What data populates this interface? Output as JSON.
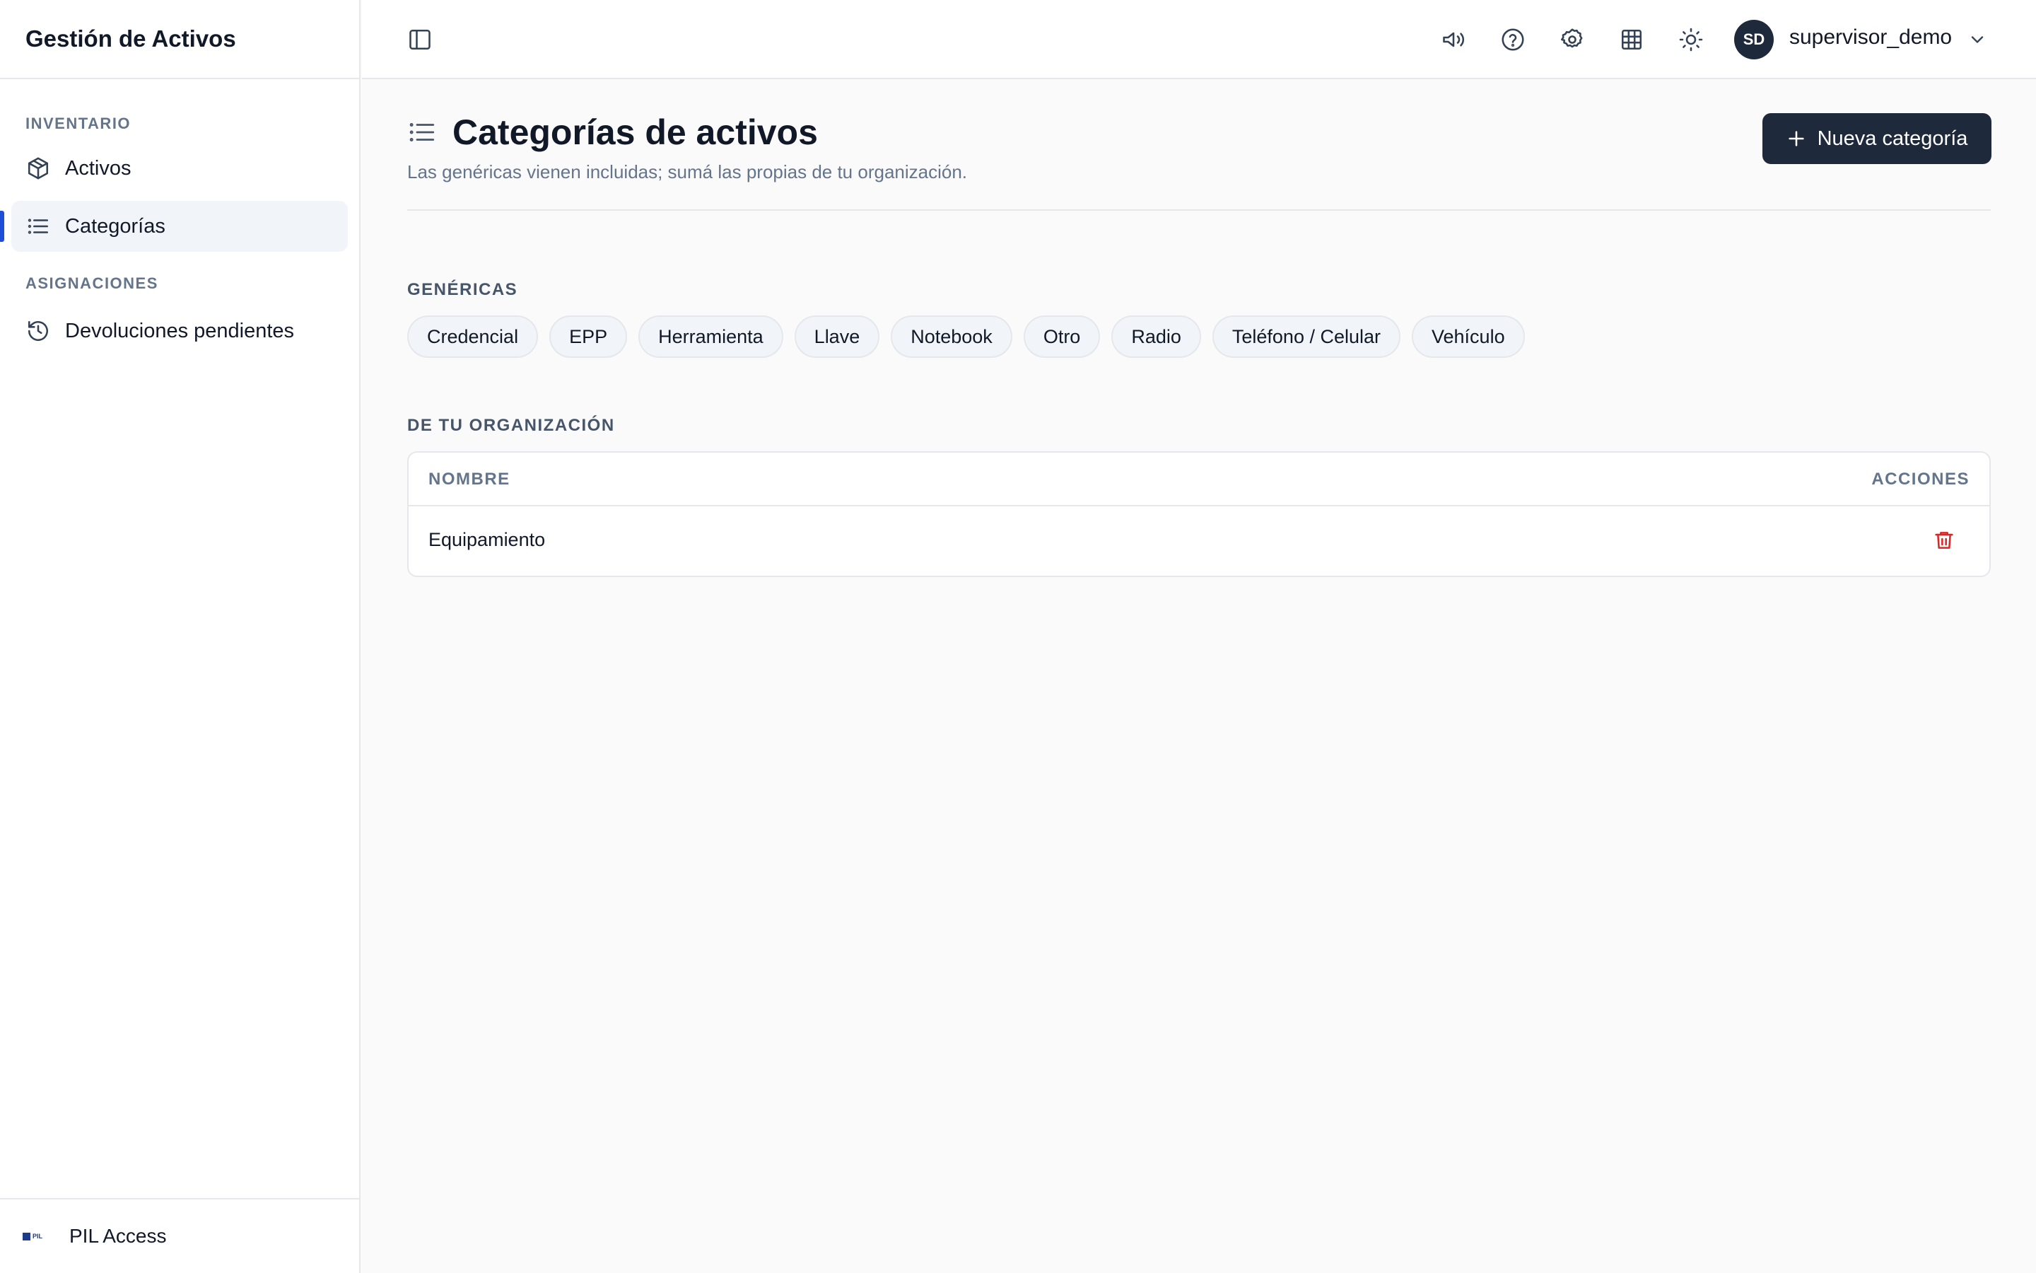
{
  "sidebar": {
    "brand": "Gestión de Activos",
    "sections": [
      {
        "label": "INVENTARIO"
      },
      {
        "label": "ASIGNACIONES"
      }
    ],
    "items": [
      {
        "label": "Activos",
        "icon": "package-icon"
      },
      {
        "label": "Categorías",
        "icon": "list-icon",
        "active": true
      },
      {
        "label": "Devoluciones pendientes",
        "icon": "history-icon"
      }
    ],
    "footer": {
      "label": "PIL Access",
      "logo_text": "PIL"
    }
  },
  "topbar": {
    "icons": [
      "sidebar-toggle-icon",
      "megaphone-icon",
      "help-icon",
      "gear-icon",
      "grid-icon",
      "sun-icon",
      "chevron-down-icon"
    ],
    "user": {
      "initials": "SD",
      "name": "supervisor_demo"
    }
  },
  "main": {
    "title": "Categorías de activos",
    "subtitle": "Las genéricas vienen incluidas; sumá las propias de tu organización.",
    "new_button": "Nueva categoría",
    "generic_label": "GENÉRICAS",
    "generic_chips": [
      "Credencial",
      "EPP",
      "Herramienta",
      "Llave",
      "Notebook",
      "Otro",
      "Radio",
      "Teléfono / Celular",
      "Vehículo"
    ],
    "org_label": "DE TU ORGANIZACIÓN",
    "table": {
      "headers": [
        "NOMBRE",
        "ACCIONES"
      ],
      "rows": [
        {
          "name": "Equipamiento"
        }
      ]
    }
  },
  "colors": {
    "primary": "#1e293b",
    "active_indicator": "#1d4ed8",
    "danger": "#dc2626",
    "muted": "#64748b"
  }
}
